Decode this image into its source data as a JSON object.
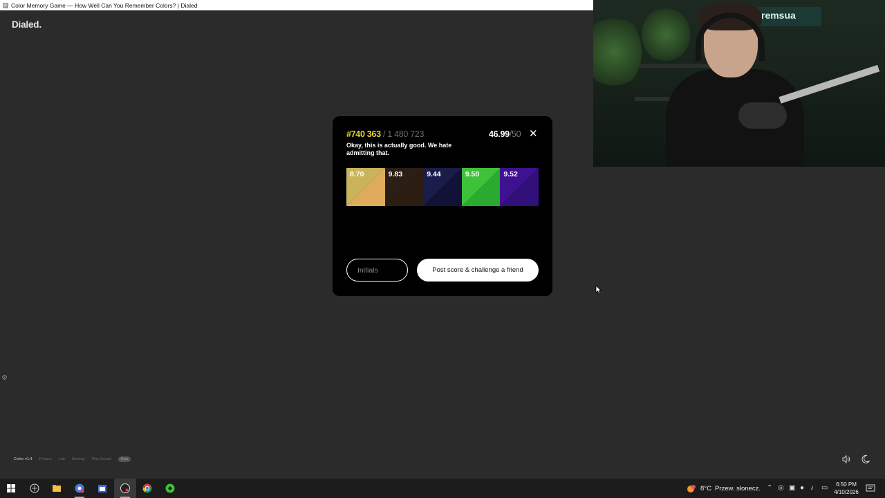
{
  "window": {
    "title": "Color Memory Game — How Well Can You Remember Colors? | Dialed"
  },
  "page": {
    "logo": "Dialed."
  },
  "result": {
    "rank": "#740 363",
    "total": "/ 1 480 723",
    "score": "46.99",
    "score_max": "/50",
    "message": "Okay, this is actually good. We hate admitting that.",
    "swatches": [
      {
        "score": "8.70",
        "target_color": "#c9b45c",
        "guess_color": "#e0ab5c"
      },
      {
        "score": "9.83",
        "target_color": "#2b1e14",
        "guess_color": "#2c1d12"
      },
      {
        "score": "9.44",
        "target_color": "#1a1d4a",
        "guess_color": "#101236"
      },
      {
        "score": "9.50",
        "target_color": "#3ec23a",
        "guess_color": "#2aaa2e"
      },
      {
        "score": "9.52",
        "target_color": "#3e1190",
        "guess_color": "#32107a"
      }
    ],
    "initials_placeholder": "Initials",
    "post_button": "Post score & challenge a friend"
  },
  "footer": {
    "version": "Color v1.4",
    "links": [
      "Privacy",
      "Lab",
      "Scoring",
      "Play Sound"
    ],
    "badge": "Beta"
  },
  "webcam": {
    "sign_text": "remsua"
  },
  "taskbar": {
    "weather_temp": "8°C",
    "weather_text": "Przew. słonecz.",
    "time": "6:50 PM",
    "date": "4/10/2026"
  },
  "colors": {
    "rank": "#e8d23a",
    "background": "#2b2b2b",
    "modal": "#000000"
  }
}
